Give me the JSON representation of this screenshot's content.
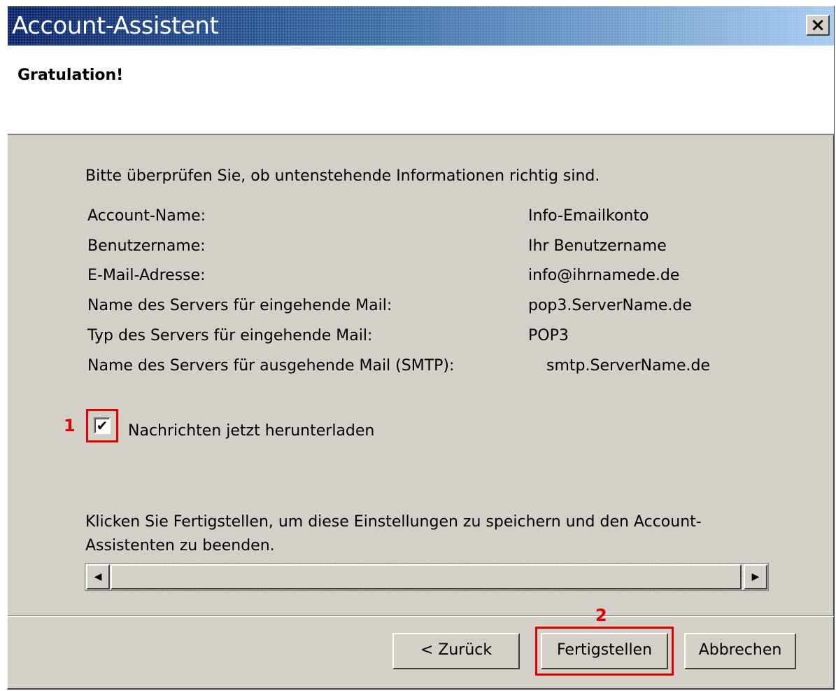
{
  "window": {
    "title": "Account-Assistent",
    "close_label": "×"
  },
  "header": {
    "title": "Gratulation!"
  },
  "content": {
    "intro": "Bitte überprüfen Sie, ob untenstehende Informationen richtig sind.",
    "info": [
      {
        "label": "Account-Name:",
        "value": "Info-Emailkonto"
      },
      {
        "label": "Benutzername:",
        "value": "Ihr Benutzername"
      },
      {
        "label": "E-Mail-Adresse:",
        "value": "info@ihrnamede.de"
      },
      {
        "label": "Name des Servers für eingehende Mail:",
        "value": "pop3.ServerName.de"
      },
      {
        "label": "Typ des Servers für eingehende Mail:",
        "value": "POP3"
      },
      {
        "label": "Name des Servers für ausgehende Mail (SMTP):",
        "value": "smtp.ServerName.de"
      }
    ],
    "checkbox": {
      "label": "Nachrichten jetzt herunterladen",
      "checked": true,
      "check_glyph": "✔"
    },
    "closing": "Klicken Sie Fertigstellen, um diese Einstellungen zu speichern und den Account-Assistenten zu beenden."
  },
  "scrollbar": {
    "left_arrow": "◀",
    "right_arrow": "▶"
  },
  "markers": {
    "one": "1",
    "two": "2"
  },
  "buttons": {
    "back": "< Zurück",
    "finish": "Fertigstellen",
    "cancel": "Abbrechen"
  },
  "colors": {
    "highlight": "#e00000",
    "title_bar_start": "#0a246a",
    "dialog_bg": "#d4d0c8"
  }
}
